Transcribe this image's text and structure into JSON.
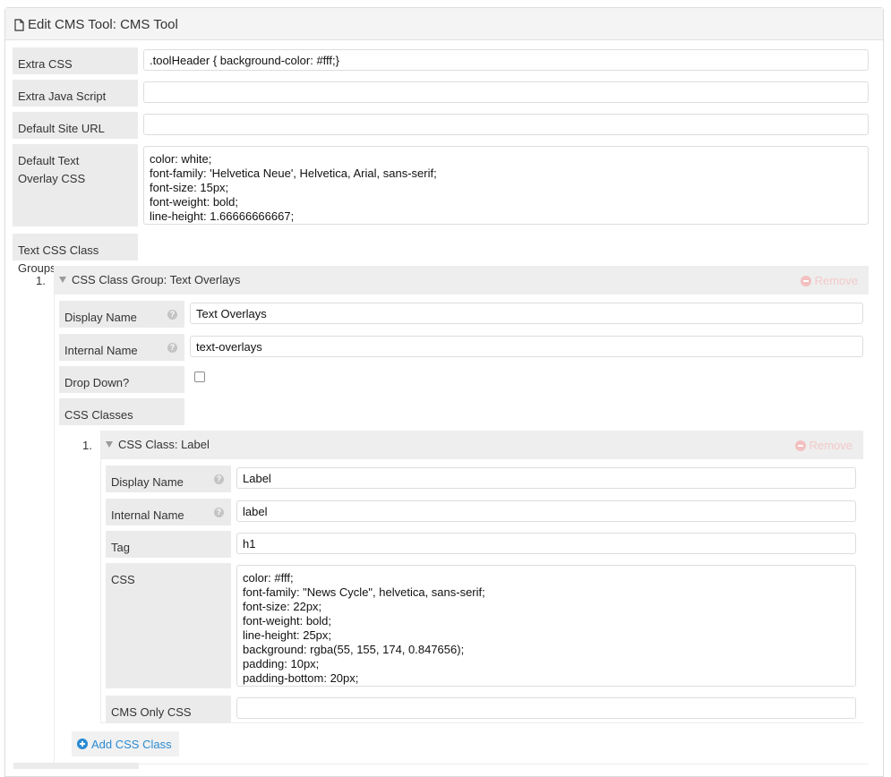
{
  "header": {
    "title": "Edit CMS Tool: CMS Tool"
  },
  "fields": {
    "extra_css": {
      "label": "Extra CSS",
      "value": ".toolHeader { background-color: #fff;}"
    },
    "extra_js": {
      "label": "Extra Java Script",
      "value": ""
    },
    "default_site_url": {
      "label": "Default Site URL",
      "value": ""
    },
    "default_text_overlay_css": {
      "label": "Default Text Overlay CSS",
      "value": "color: white;\nfont-family: 'Helvetica Neue', Helvetica, Arial, sans-serif;\nfont-size: 15px;\nfont-weight: bold;\nline-height: 1.66666666667;"
    },
    "text_css_class_groups": {
      "label": "Text CSS Class Groups"
    }
  },
  "group": {
    "index": "1.",
    "title": "CSS Class Group: Text Overlays",
    "remove_label": "Remove",
    "display_name": {
      "label": "Display Name",
      "value": "Text Overlays"
    },
    "internal_name": {
      "label": "Internal Name",
      "value": "text-overlays"
    },
    "drop_down": {
      "label": "Drop Down?",
      "checked": false
    },
    "css_classes": {
      "label": "CSS Classes"
    },
    "add_css_class_label": "Add CSS Class"
  },
  "css_class": {
    "index": "1.",
    "title": "CSS Class: Label",
    "remove_label": "Remove",
    "display_name": {
      "label": "Display Name",
      "value": "Label"
    },
    "internal_name": {
      "label": "Internal Name",
      "value": "label"
    },
    "tag": {
      "label": "Tag",
      "value": "h1"
    },
    "css": {
      "label": "CSS",
      "value": "color: #fff;\nfont-family: \"News Cycle\", helvetica, sans-serif;\nfont-size: 22px;\nfont-weight: bold;\nline-height: 25px;\nbackground: rgba(55, 155, 174, 0.847656);\npadding: 10px;\npadding-bottom: 20px;"
    },
    "cms_only_css": {
      "label": "CMS Only CSS",
      "value": ""
    }
  },
  "icons": {
    "title_icon": "document-icon",
    "help_icon": "question-circle-icon",
    "remove_icon": "minus-circle-icon",
    "collapse_icon": "triangle-down-icon",
    "add_icon": "plus-circle-icon"
  },
  "colors": {
    "accent": "#2a8ad2",
    "remove": "#f3c0c0",
    "label_bg": "#ebebeb"
  }
}
